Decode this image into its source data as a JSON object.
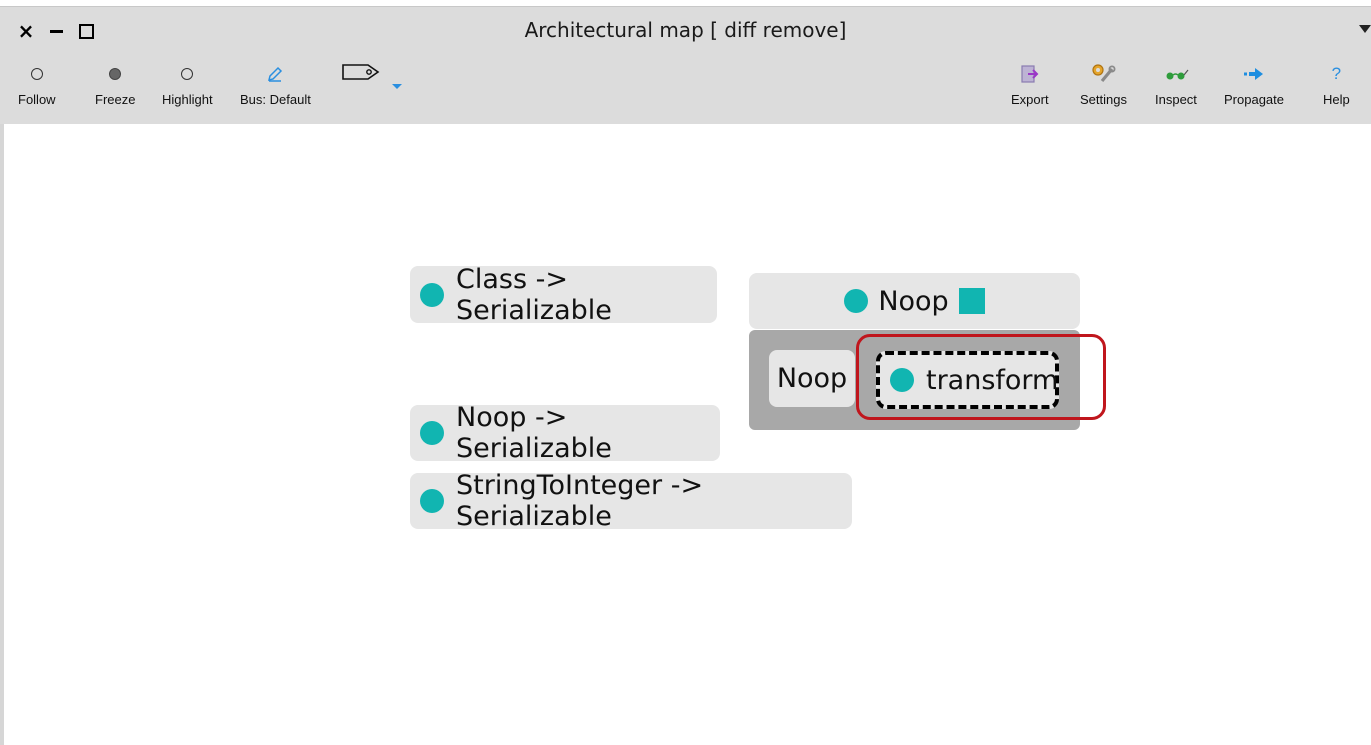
{
  "window": {
    "title": "Architectural map [ diff remove]",
    "controls": {
      "close": "×",
      "minimize": "−",
      "maximize": "□"
    }
  },
  "toolbar": {
    "left": [
      {
        "label": "Follow",
        "icon": "circle-outline-icon"
      },
      {
        "label": "Freeze",
        "icon": "circle-filled-icon"
      },
      {
        "label": "Highlight",
        "icon": "circle-outline-icon"
      },
      {
        "label": "Bus: Default",
        "icon": "pencil-icon"
      },
      {
        "label": "",
        "icon": "tag-icon"
      }
    ],
    "right": [
      {
        "label": "Export",
        "icon": "export-icon"
      },
      {
        "label": "Settings",
        "icon": "wrench-gear-icon"
      },
      {
        "label": "Inspect",
        "icon": "glasses-icon"
      },
      {
        "label": "Propagate",
        "icon": "arrow-right-icon"
      },
      {
        "label": "Help",
        "icon": "question-icon"
      }
    ]
  },
  "map": {
    "nodes": [
      {
        "label": "Class -> Serializable"
      },
      {
        "label": "Noop -> Serializable"
      },
      {
        "label": "StringToInteger -> Serializable"
      }
    ],
    "group": {
      "header": "Noop",
      "inner_label": "Noop",
      "method": "transform"
    }
  },
  "colors": {
    "accent": "#11b5b1",
    "highlight": "#c0161d",
    "toolbar_bg": "#dcdcdc",
    "node_bg": "#e6e6e6",
    "group_bg": "#a8a8a8"
  }
}
